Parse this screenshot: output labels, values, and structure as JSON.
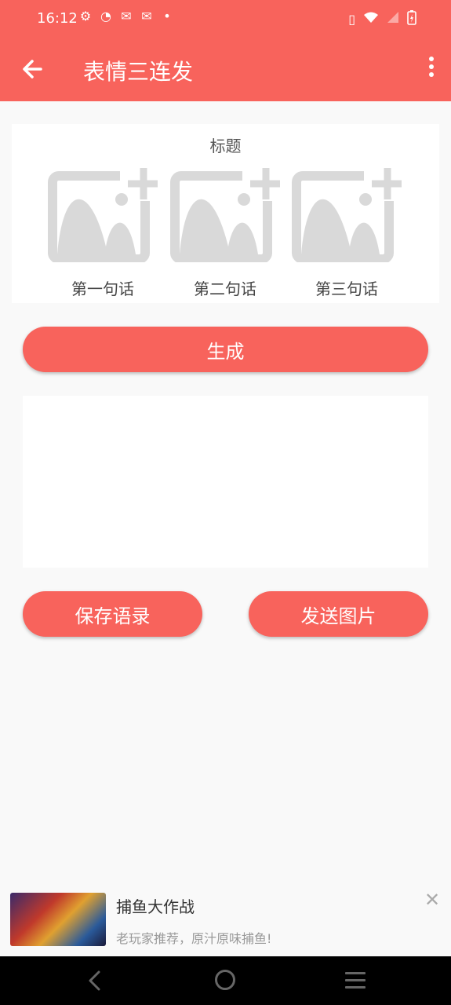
{
  "colors": {
    "accent": "#f8635c",
    "background": "#f9f9f9",
    "placeholder": "#d9d9d9"
  },
  "status_bar": {
    "time": "16:12",
    "left_icons": [
      "gear-icon",
      "speedometer-icon",
      "mail-icon",
      "mail-icon",
      "dot-icon"
    ],
    "right_icons": [
      "vibrate-icon",
      "wifi-icon",
      "signal-icon",
      "battery-charging-icon"
    ]
  },
  "toolbar": {
    "title": "表情三连发"
  },
  "card": {
    "title": "标题",
    "slots": [
      {
        "label": "第一句话",
        "icon": "add-image-icon"
      },
      {
        "label": "第二句话",
        "icon": "add-image-icon"
      },
      {
        "label": "第三句话",
        "icon": "add-image-icon"
      }
    ]
  },
  "buttons": {
    "generate": "生成",
    "save": "保存语录",
    "send": "发送图片"
  },
  "ad": {
    "title": "捕鱼大作战",
    "description": "老玩家推荐，原汁原味捕鱼!"
  }
}
